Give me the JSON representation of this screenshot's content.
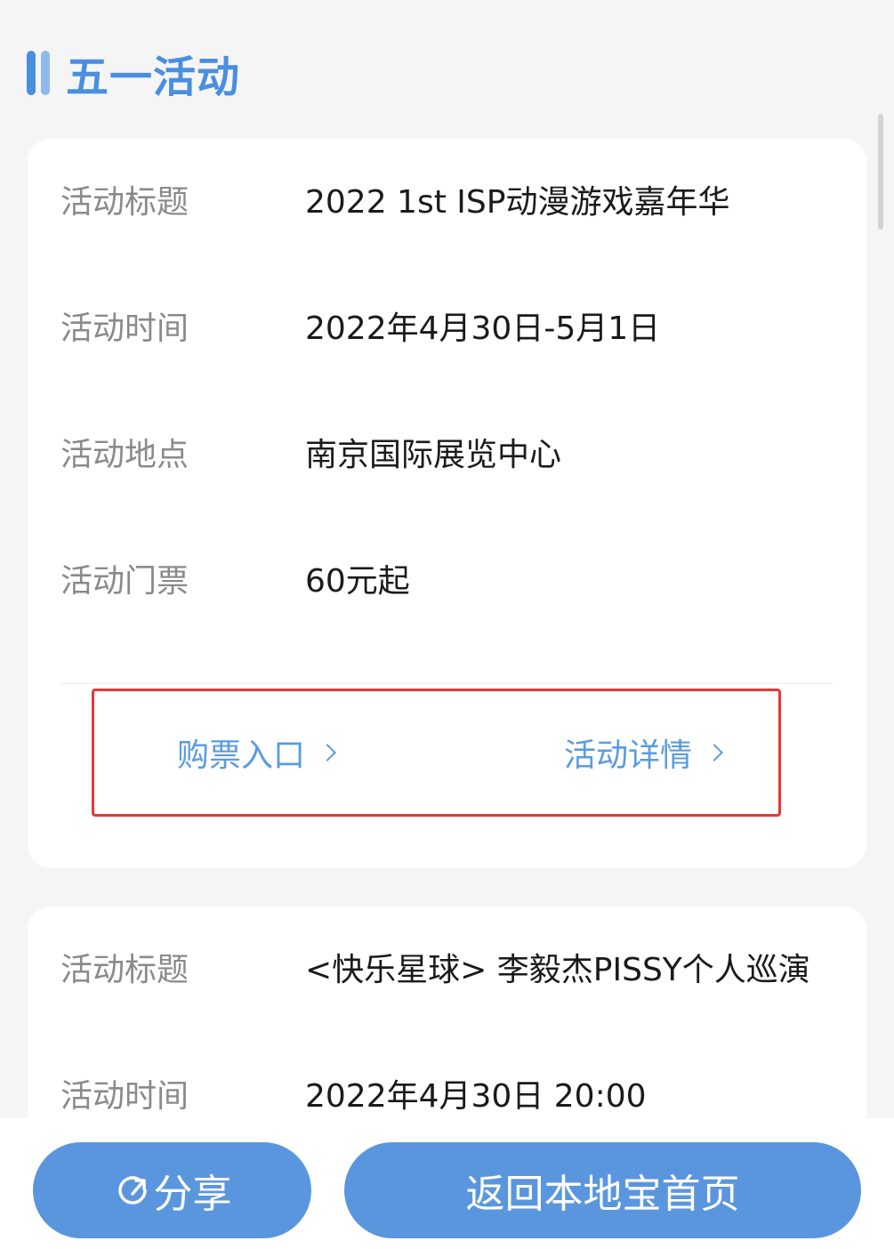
{
  "section": {
    "title": "五一活动"
  },
  "events": [
    {
      "rows": [
        {
          "label": "活动标题",
          "value": "2022 1st ISP动漫游戏嘉年华"
        },
        {
          "label": "活动时间",
          "value": "2022年4月30日-5月1日"
        },
        {
          "label": "活动地点",
          "value": "南京国际展览中心"
        },
        {
          "label": "活动门票",
          "value": "60元起"
        }
      ],
      "links": {
        "tickets": "购票入口",
        "details": "活动详情"
      }
    },
    {
      "rows": [
        {
          "label": "活动标题",
          "value": "<快乐星球> 李毅杰PISSY个人巡演"
        },
        {
          "label": "活动时间",
          "value": "2022年4月30日 20:00"
        }
      ]
    }
  ],
  "bottom": {
    "share_label": "分享",
    "home_label": "返回本地宝首页"
  },
  "colors": {
    "accent": "#4a8ee0",
    "button": "#5a96dd",
    "link": "#5b9be0",
    "highlight": "#e53935"
  }
}
